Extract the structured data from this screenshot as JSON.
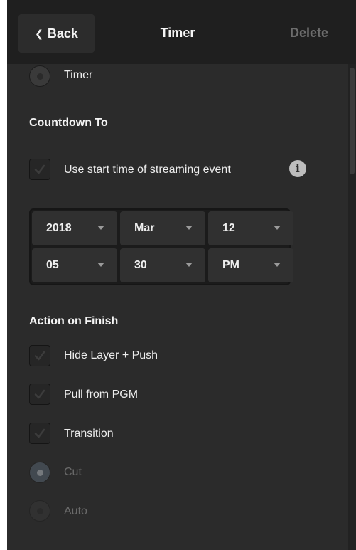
{
  "header": {
    "back_label": "Back",
    "title": "Timer",
    "delete_label": "Delete"
  },
  "mode": {
    "timer_label": "Timer"
  },
  "countdown": {
    "heading": "Countdown To",
    "use_start_time_label": "Use start time of streaming event",
    "year": "2018",
    "month": "Mar",
    "day": "12",
    "hour": "05",
    "minute": "30",
    "ampm": "PM"
  },
  "action": {
    "heading": "Action on Finish",
    "hide_layer_label": "Hide Layer + Push",
    "pull_pgm_label": "Pull from PGM",
    "transition_label": "Transition",
    "cut_label": "Cut",
    "auto_label": "Auto"
  },
  "icons": {
    "back": "chevron-left-icon",
    "info": "info-icon",
    "check": "checkmark-icon",
    "caret": "caret-down-icon"
  },
  "colors": {
    "background": "#2b2b2b",
    "header": "#1f1f1f",
    "accent_radio": "#5e6e7e"
  }
}
